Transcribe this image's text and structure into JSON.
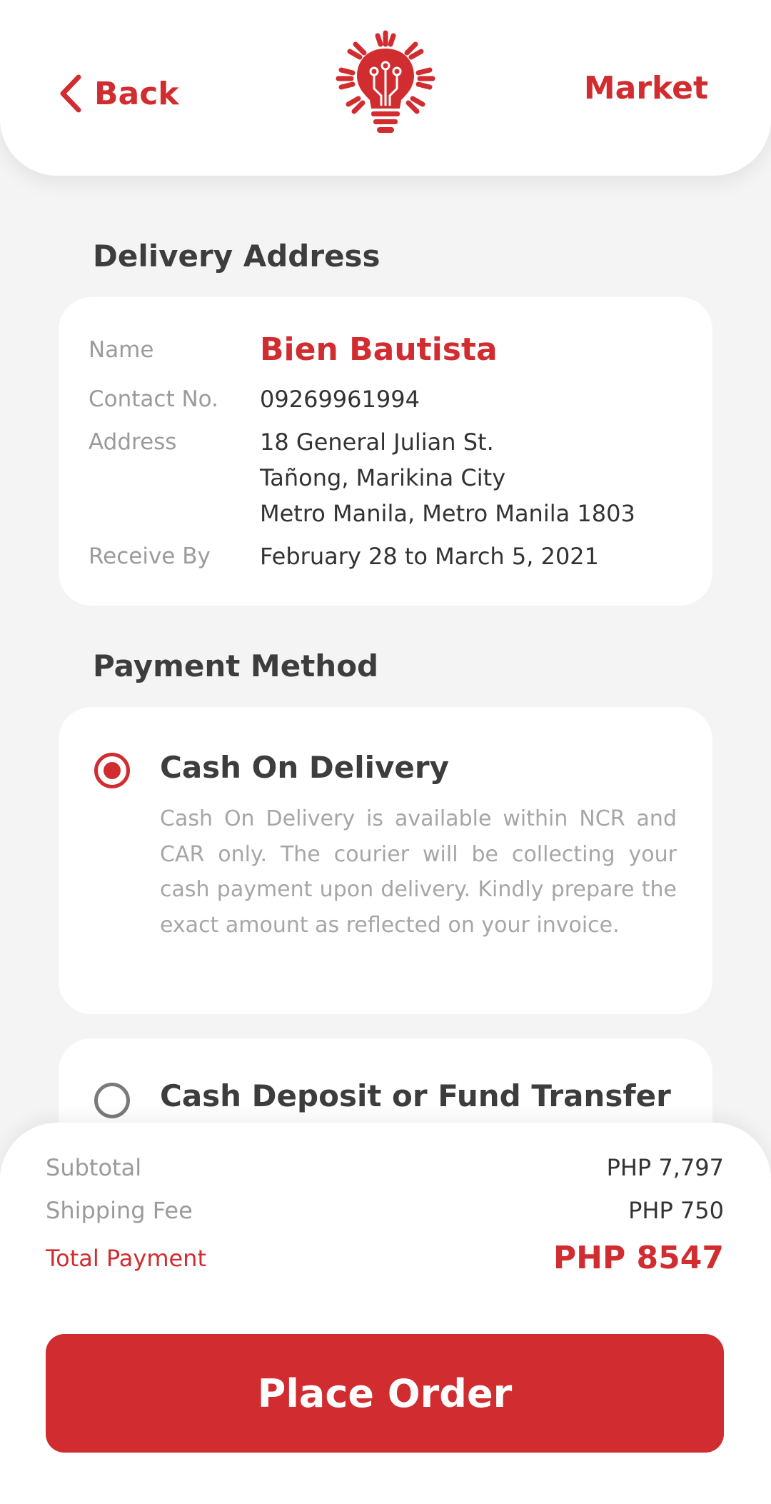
{
  "header": {
    "back_label": "Back",
    "market_label": "Market",
    "logo_icon": "lightbulb-sun-circuit-logo"
  },
  "delivery": {
    "title": "Delivery Address",
    "name_label": "Name",
    "name": "Bien Bautista",
    "contact_label": "Contact No.",
    "contact": "09269961994",
    "address_label": "Address",
    "address_lines": [
      "18 General Julian St.",
      "Tañong, Marikina City",
      "Metro Manila, Metro Manila 1803"
    ],
    "receive_label": "Receive By",
    "receive": "February 28 to March 5, 2021"
  },
  "payment": {
    "title": "Payment Method",
    "options": [
      {
        "label": "Cash On Delivery",
        "selected": true,
        "description": "Cash On Delivery is available within NCR and CAR only. The courier will be collecting your cash payment upon delivery. Kindly prepare the exact amount as reflected on your invoice."
      },
      {
        "label": "Cash Deposit or Fund Transfer",
        "selected": false
      }
    ]
  },
  "summary": {
    "subtotal_label": "Subtotal",
    "subtotal": "PHP 7,797",
    "shipping_label": "Shipping Fee",
    "shipping": "PHP 750",
    "total_label": "Total Payment",
    "total": "PHP 8547",
    "place_order_label": "Place Order"
  },
  "colors": {
    "accent": "#d12c2f",
    "background": "#f4f4f4",
    "card": "#ffffff"
  }
}
